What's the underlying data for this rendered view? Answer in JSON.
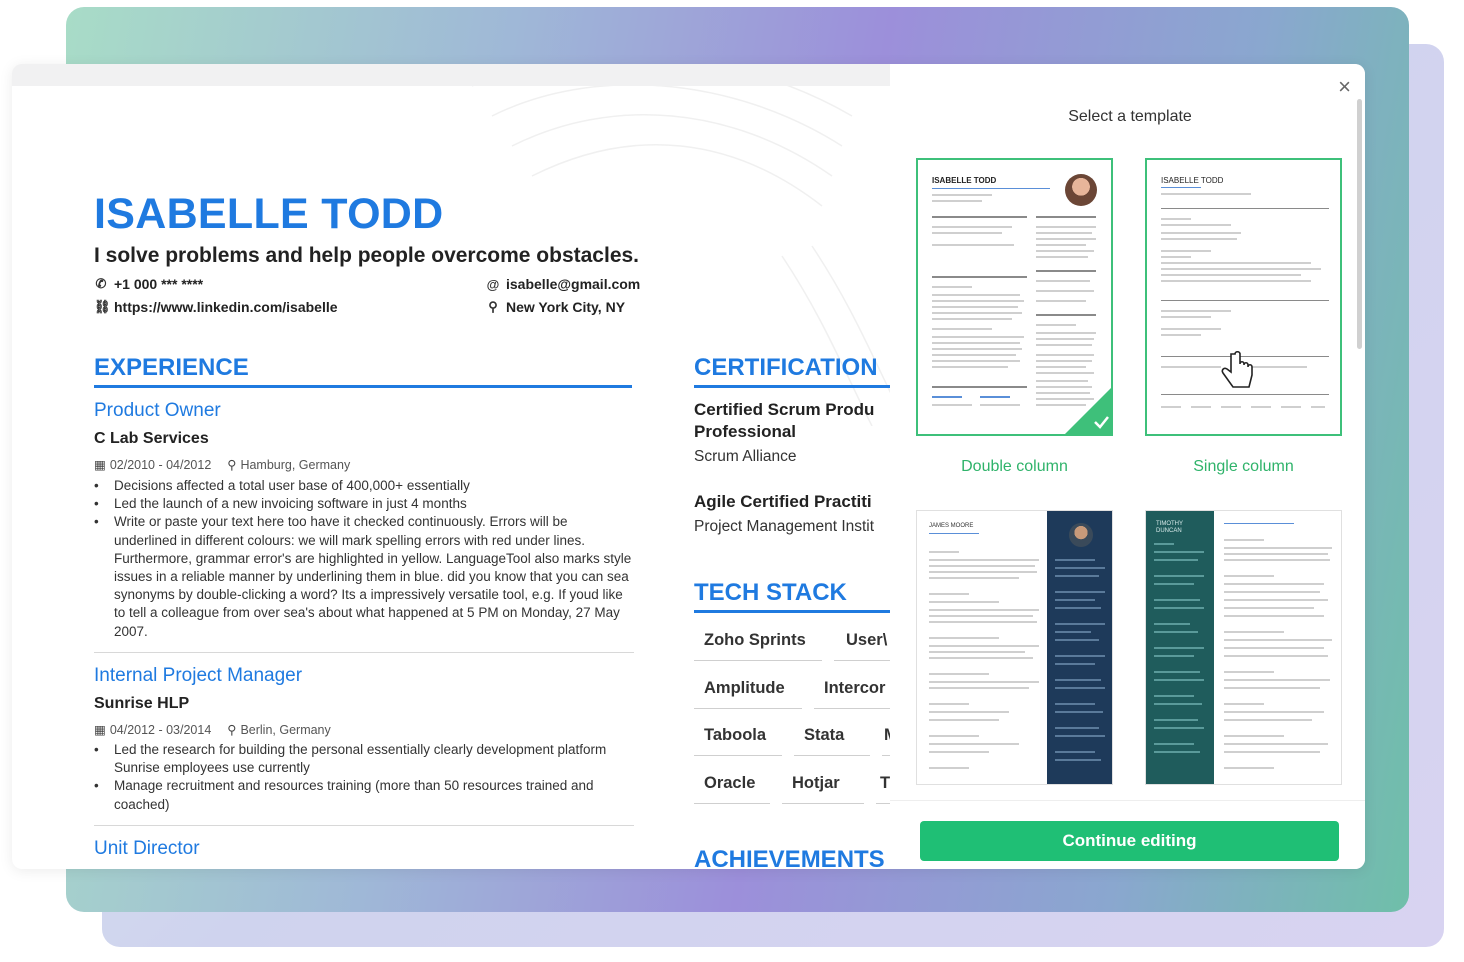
{
  "resume": {
    "name": "ISABELLE TODD",
    "tagline": "I solve problems and help people overcome obstacles.",
    "phone": "+1 000 *** ****",
    "email": "isabelle@gmail.com",
    "linkedin": "https://www.linkedin.com/isabelle",
    "location": "New York City, NY",
    "experience_title": "EXPERIENCE",
    "jobs": [
      {
        "title": "Product Owner",
        "company": "C Lab Services",
        "dates": "02/2010 - 04/2012",
        "location": "Hamburg, Germany",
        "bullets": [
          "Decisions affected a total user base of 400,000+ essentially",
          "Led the launch of a new invoicing software in just 4 months",
          "Write or paste your text here too have it checked continuously. Errors will be underlined in different colours: we will mark spelling errors with red under lines. Furthermore, grammar error's are highlighted in yellow. LanguageTool also marks style issues in a reliable manner by underlining them in blue. did you know that you can sea synonyms by double-clicking a word? Its a impressively versatile tool, e.g. If youd like to tell a colleague from over sea's about what happened at 5 PM on Monday, 27 May 2007."
        ]
      },
      {
        "title": "Internal Project Manager",
        "company": "Sunrise HLP",
        "dates": "04/2012 - 03/2014",
        "location": "Berlin, Germany",
        "bullets": [
          "Led the research for building the personal essentially clearly development platform Sunrise employees use currently",
          "Manage recruitment and resources training (more than 50 resources trained and coached)"
        ]
      },
      {
        "title": "Unit Director"
      }
    ],
    "certification_title": "CERTIFICATION",
    "certifications": [
      {
        "name_line1": "Certified Scrum Produ",
        "name_line2": "Professional",
        "org": "Scrum Alliance"
      },
      {
        "name_line1": "Agile Certified Practiti",
        "org": "Project Management Instit"
      }
    ],
    "techstack_title": "TECH STACK",
    "tech": [
      "Zoho Sprints",
      "User\\",
      "Amplitude",
      "Intercor",
      "Taboola",
      "Stata",
      "M",
      "Oracle",
      "Hotjar",
      "T"
    ],
    "achievements_title": "ACHIEVEMENTS"
  },
  "panel": {
    "title": "Select a template",
    "close": "×",
    "templates": [
      {
        "label": "Double column",
        "selected": true,
        "preview_name": "ISABELLE TODD"
      },
      {
        "label": "Single column",
        "selected": false,
        "preview_name": "ISABELLE TODD"
      },
      {
        "label": "",
        "preview_name": "JAMES MOORE"
      },
      {
        "label": "",
        "preview_name": "TIMOTHY DUNCAN"
      }
    ],
    "continue_label": "Continue editing"
  },
  "colors": {
    "accent": "#1f7ae0",
    "green": "#1fbf75",
    "dark_sidebar": "#1e3a5a",
    "teal_sidebar": "#1f5c5c"
  }
}
